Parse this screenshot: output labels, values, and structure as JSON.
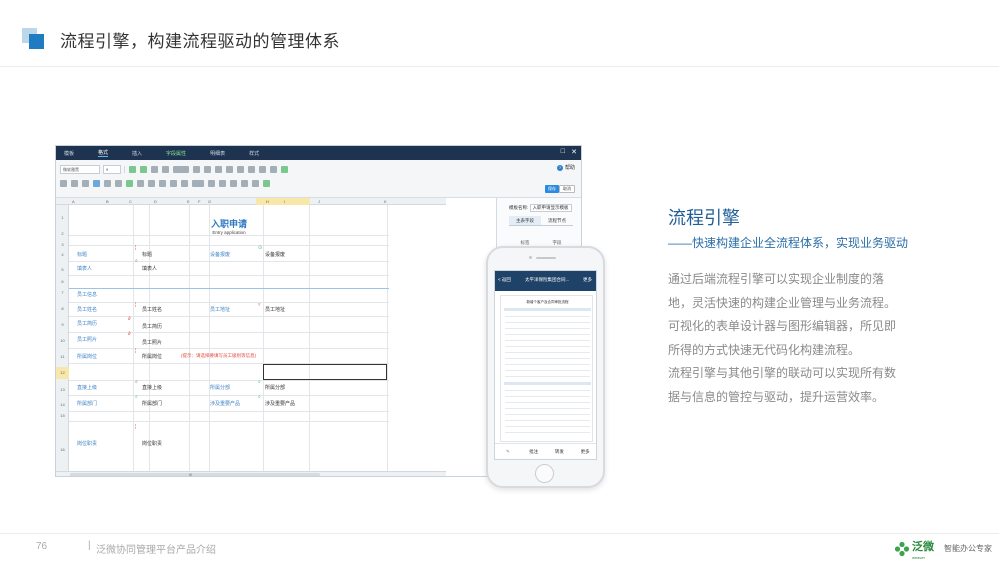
{
  "header": {
    "title": "流程引擎，构建流程驱动的管理体系"
  },
  "app": {
    "menu": [
      {
        "label": "模板",
        "state": "normal"
      },
      {
        "label": "格式",
        "state": "active"
      },
      {
        "label": "插入",
        "state": "normal"
      },
      {
        "label": "字段属性",
        "state": "accent"
      },
      {
        "label": "明细表",
        "state": "normal"
      },
      {
        "label": "样式",
        "state": "normal"
      }
    ],
    "window_controls": {
      "minimize": "□",
      "close": "✕"
    },
    "toolbar": {
      "font_select": "微软雅黑",
      "size_select": "9",
      "help_label": "帮助",
      "save_label": "保存",
      "cancel_label": "取消"
    },
    "columns": [
      "A",
      "B",
      "C",
      "D",
      "E",
      "F",
      "G",
      "H",
      "I",
      "J",
      "K"
    ],
    "rows": [
      "1",
      "2",
      "3",
      "4",
      "5",
      "6",
      "7",
      "8",
      "9",
      "10",
      "11",
      "12",
      "13",
      "14",
      "15",
      "16"
    ],
    "selected_row": "12",
    "form": {
      "title": "入职申请",
      "subtitle": "Entry application",
      "cells": [
        {
          "id": "c-title-label",
          "text": "标题",
          "kind": "lbl"
        },
        {
          "id": "c-title-value",
          "text": "标题",
          "kind": "val"
        },
        {
          "id": "c-device-label",
          "text": "设备报废",
          "kind": "lbl"
        },
        {
          "id": "c-device-value",
          "text": "设备报废",
          "kind": "val"
        },
        {
          "id": "c-filler-label",
          "text": "填表人",
          "kind": "lbl"
        },
        {
          "id": "c-filler-value",
          "text": "填表人",
          "kind": "val"
        },
        {
          "id": "c-section",
          "text": "员工信息",
          "kind": "lbl"
        },
        {
          "id": "c-name-label",
          "text": "员工姓名",
          "kind": "lbl"
        },
        {
          "id": "c-name-value",
          "text": "员工姓名",
          "kind": "val"
        },
        {
          "id": "c-place-label",
          "text": "员工地址",
          "kind": "lbl"
        },
        {
          "id": "c-place-value",
          "text": "员工地址",
          "kind": "val"
        },
        {
          "id": "c-resume-label",
          "text": "员工简历",
          "kind": "lbl"
        },
        {
          "id": "c-resume-value",
          "text": "员工简历",
          "kind": "val"
        },
        {
          "id": "c-photo-label",
          "text": "员工照片",
          "kind": "lbl"
        },
        {
          "id": "c-photo-value",
          "text": "员工照片",
          "kind": "val"
        },
        {
          "id": "c-post-label",
          "text": "所属岗位",
          "kind": "lbl"
        },
        {
          "id": "c-post-value",
          "text": "所属岗位",
          "kind": "val"
        },
        {
          "id": "c-post-note",
          "text": "(提示：请选择要填写员工级别等信息)",
          "kind": "red"
        },
        {
          "id": "c-super-label",
          "text": "直接上级",
          "kind": "lbl"
        },
        {
          "id": "c-super-value",
          "text": "直接上级",
          "kind": "val"
        },
        {
          "id": "c-div-label",
          "text": "所属分部",
          "kind": "lbl"
        },
        {
          "id": "c-div-value",
          "text": "所属分部",
          "kind": "val"
        },
        {
          "id": "c-dept-label",
          "text": "所属部门",
          "kind": "lbl"
        },
        {
          "id": "c-dept-value",
          "text": "所属部门",
          "kind": "val"
        },
        {
          "id": "c-prod-label",
          "text": "涉及重要产品",
          "kind": "lbl"
        },
        {
          "id": "c-prod-value",
          "text": "涉及重要产品",
          "kind": "val"
        },
        {
          "id": "c-duty-label",
          "text": "岗位职责",
          "kind": "lbl"
        },
        {
          "id": "c-duty-value",
          "text": "岗位职责",
          "kind": "val"
        }
      ]
    },
    "props": {
      "template_label": "模板名称:",
      "template_value": "入职申请显示模板",
      "tab1": "主表字段",
      "tab2": "流程节点",
      "sub1": "标签",
      "sub2": "字段"
    },
    "scroll_mark": "|||"
  },
  "phone": {
    "back": "< 返回",
    "title": "太平洋保险集团合同...",
    "more": "更多",
    "doc_title": "新增个客户及合同审批流程",
    "tabs": [
      "",
      "批注",
      "转发",
      "更多"
    ]
  },
  "feature": {
    "title": "流程引擎",
    "subtitle": "——快速构建企业全流程体系，实现业务驱动",
    "body": [
      "通过后端流程引擎可以实现企业制度的落",
      "地，灵活快速的构建企业管理与业务流程。",
      "可视化的表单设计器与图形编辑器，所见即",
      "所得的方式快速无代码化构建流程。",
      "流程引擎与其他引擎的联动可以实现所有数",
      "据与信息的管控与驱动，提升运营效率。"
    ]
  },
  "footer": {
    "page_number": "76",
    "separator": "|",
    "doc_title": "泛微协同管理平台产品介绍",
    "brand_name": "泛微",
    "brand_en": "weaver",
    "slogan": "智能办公专家"
  },
  "colors": {
    "accent": "#1f7cc1",
    "title_blue": "#1f5e96",
    "menubar": "#1e3350",
    "brand_green": "#2a8a3e",
    "note_red": "#e0473b"
  }
}
